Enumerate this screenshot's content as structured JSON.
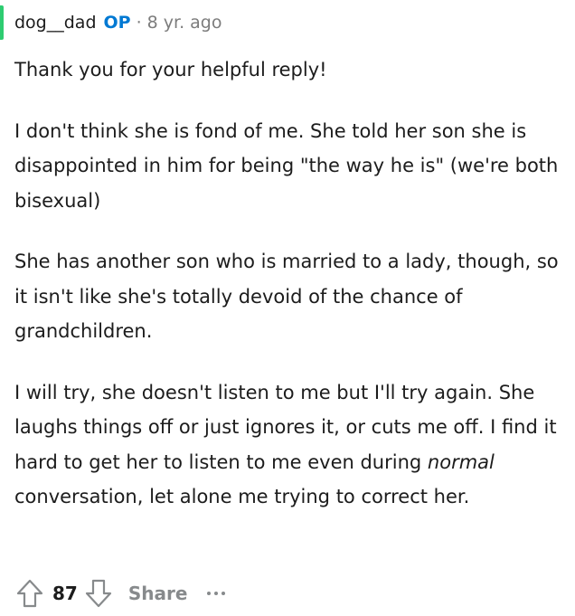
{
  "comment": {
    "author": "dog__dad",
    "op_badge": "OP",
    "separator": "·",
    "age": "8 yr. ago",
    "paragraphs": {
      "p1": "Thank you for your helpful reply!",
      "p2": "I don't think she is fond of me. She told her son she is disappointed in him for being \"the way he is\" (we're both bisexual)",
      "p3": "She has another son who is married to a lady, though, so it isn't like she's totally devoid of the chance of grandchildren.",
      "p4_before": "I will try, she doesn't listen to me but I'll try again. She laughs things off or just ignores it, or cuts me off. I find it hard to get her to listen to me even during ",
      "p4_em": "normal",
      "p4_after": " conversation, let alone me trying to correct her."
    }
  },
  "actions": {
    "score": "87",
    "share_label": "Share",
    "upvote_icon": "arrow-up-icon",
    "downvote_icon": "arrow-down-icon",
    "more_icon": "more-dots-icon"
  },
  "colors": {
    "accent": "#0079d3",
    "thread_line": "#2ecc71",
    "muted": "#878a8c",
    "text": "#1c1c1c"
  }
}
